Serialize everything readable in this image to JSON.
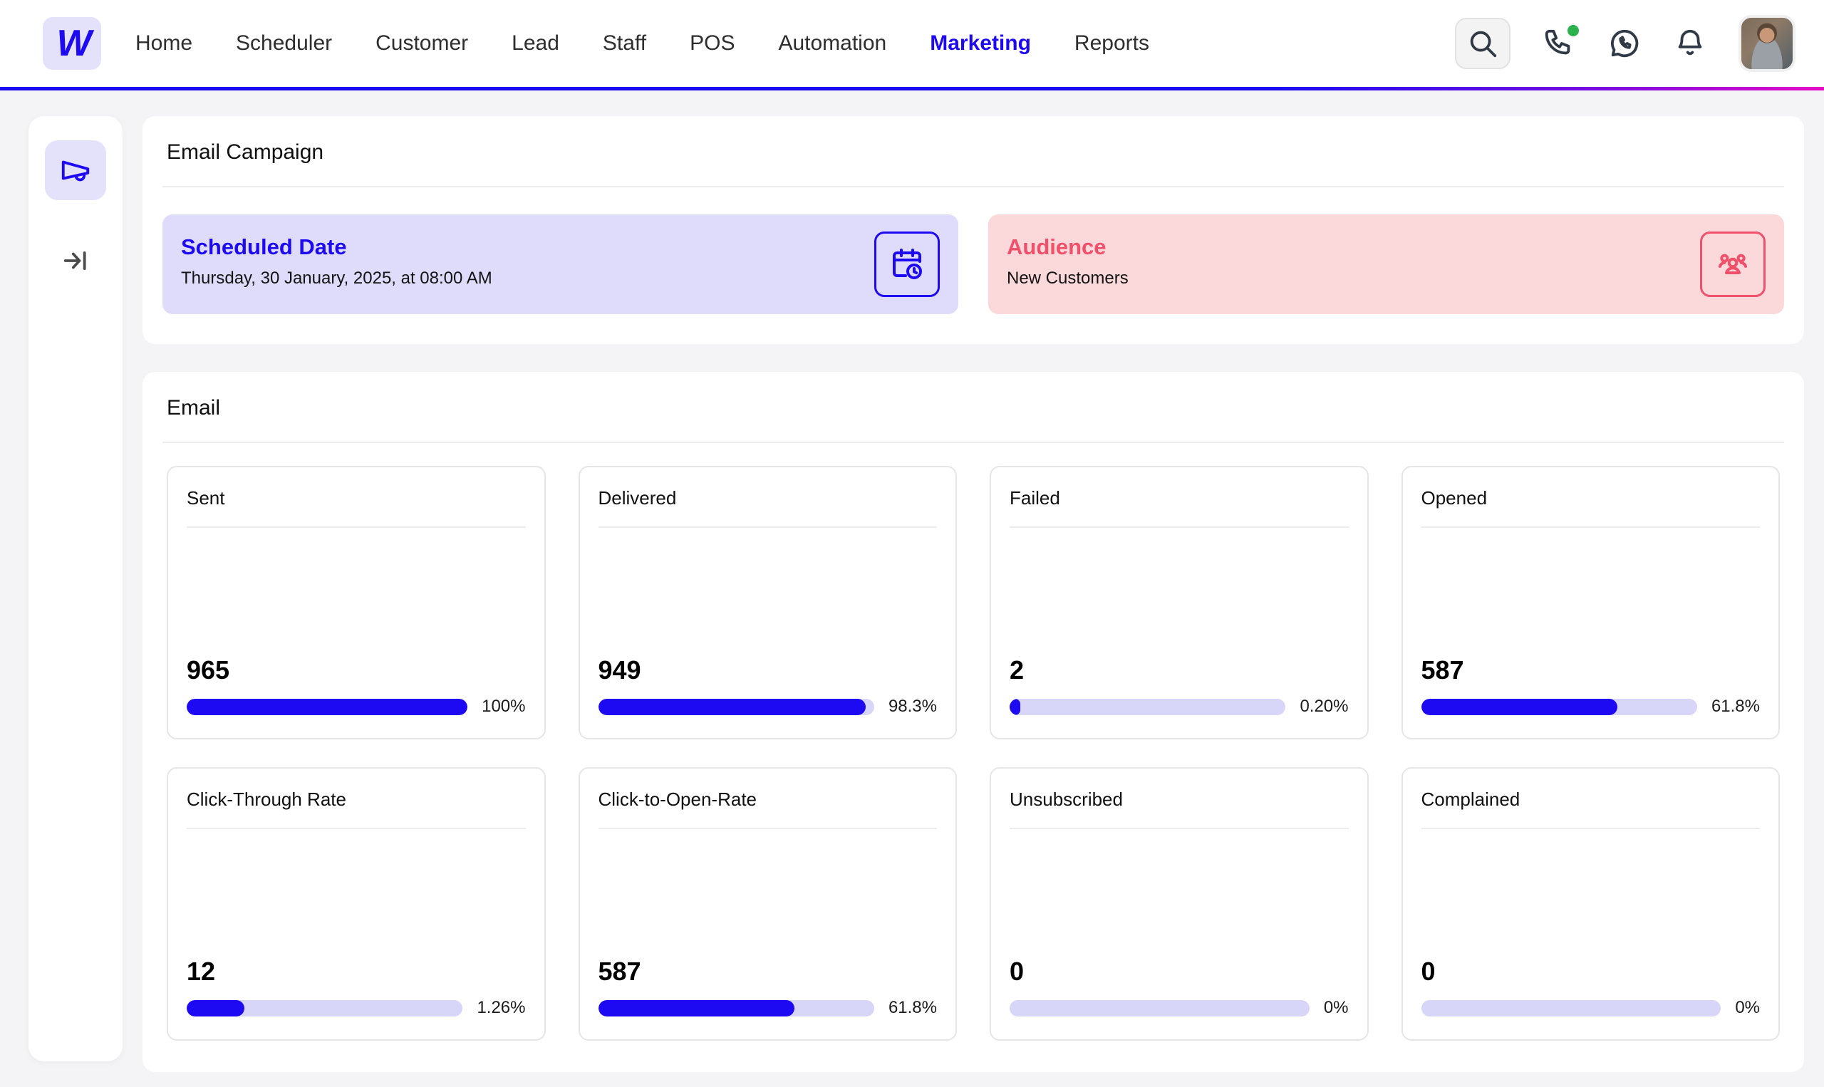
{
  "colors": {
    "accent_blue": "#1d0af2",
    "accent_pink": "#f0506a",
    "lavender_bg": "#dedcfa",
    "pink_bg": "#fbd9db",
    "track": "#d7d6f8",
    "gradient_end": "#e60ac8",
    "online_dot": "#2bb24c"
  },
  "header": {
    "logo_letter": "W",
    "nav_items": [
      {
        "label": "Home",
        "active": false
      },
      {
        "label": "Scheduler",
        "active": false
      },
      {
        "label": "Customer",
        "active": false
      },
      {
        "label": "Lead",
        "active": false
      },
      {
        "label": "Staff",
        "active": false
      },
      {
        "label": "POS",
        "active": false
      },
      {
        "label": "Automation",
        "active": false
      },
      {
        "label": "Marketing",
        "active": true
      },
      {
        "label": "Reports",
        "active": false
      }
    ],
    "icons": [
      "search-icon",
      "phone-icon",
      "whatsapp-icon",
      "bell-icon",
      "avatar"
    ]
  },
  "sidebar": {
    "items": [
      {
        "icon": "megaphone-icon",
        "selected": true
      },
      {
        "icon": "arrow-to-bar-icon",
        "selected": false
      }
    ]
  },
  "campaign": {
    "title": "Email Campaign",
    "scheduled": {
      "title": "Scheduled Date",
      "subtitle": "Thursday, 30 January, 2025, at 08:00 AM",
      "icon": "calendar-clock-icon"
    },
    "audience": {
      "title": "Audience",
      "subtitle": "New Customers",
      "icon": "users-icon"
    }
  },
  "email": {
    "title": "Email",
    "metrics": [
      {
        "label": "Sent",
        "value": "965",
        "percent": "100%",
        "fill": 100
      },
      {
        "label": "Delivered",
        "value": "949",
        "percent": "98.3%",
        "fill": 97
      },
      {
        "label": "Failed",
        "value": "2",
        "percent": "0.20%",
        "fill": 4
      },
      {
        "label": "Opened",
        "value": "587",
        "percent": "61.8%",
        "fill": 71
      },
      {
        "label": "Click-Through Rate",
        "value": "12",
        "percent": "1.26%",
        "fill": 21
      },
      {
        "label": "Click-to-Open-Rate",
        "value": "587",
        "percent": "61.8%",
        "fill": 71
      },
      {
        "label": "Unsubscribed",
        "value": "0",
        "percent": "0%",
        "fill": 0
      },
      {
        "label": "Complained",
        "value": "0",
        "percent": "0%",
        "fill": 0
      }
    ]
  }
}
